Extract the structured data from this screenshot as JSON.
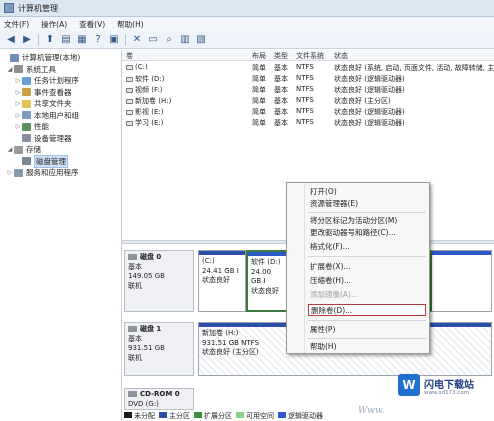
{
  "window": {
    "title": "计算机管理"
  },
  "menu": [
    "文件(F)",
    "操作(A)",
    "查看(V)",
    "帮助(H)"
  ],
  "toolbar": {
    "icons": [
      "back-icon",
      "forward-icon",
      "up-icon",
      "show-tree-icon",
      "properties-icon",
      "help-icon",
      "delete-icon",
      "open-folder-icon",
      "search-icon",
      "export-icon",
      "view-icon"
    ]
  },
  "tree": [
    {
      "label": "计算机管理(本地)",
      "level": 0,
      "expander": ""
    },
    {
      "label": "系统工具",
      "level": 1,
      "expander": "◢"
    },
    {
      "label": "任务计划程序",
      "level": 2,
      "expander": "▷"
    },
    {
      "label": "事件查看器",
      "level": 2,
      "expander": "▷"
    },
    {
      "label": "共享文件夹",
      "level": 2,
      "expander": "▷"
    },
    {
      "label": "本地用户和组",
      "level": 2,
      "expander": "▷"
    },
    {
      "label": "性能",
      "level": 2,
      "expander": "▷"
    },
    {
      "label": "设备管理器",
      "level": 2,
      "expander": ""
    },
    {
      "label": "存储",
      "level": 1,
      "expander": "◢"
    },
    {
      "label": "磁盘管理",
      "level": 2,
      "expander": ""
    },
    {
      "label": "服务和应用程序",
      "level": 1,
      "expander": "▷"
    }
  ],
  "volume_table": {
    "headers": [
      "卷",
      "布局",
      "类型",
      "文件系统",
      "状态"
    ],
    "rows": [
      [
        "(C:)",
        "简单",
        "基本",
        "NTFS",
        "状态良好 (系统, 启动, 页面文件, 活动, 故障转储, 主分区)"
      ],
      [
        "软件 (D:)",
        "简单",
        "基本",
        "NTFS",
        "状态良好 (逻辑驱动器)"
      ],
      [
        "视频 (F:)",
        "简单",
        "基本",
        "NTFS",
        "状态良好 (逻辑驱动器)"
      ],
      [
        "新加卷 (H:)",
        "简单",
        "基本",
        "NTFS",
        "状态良好 (主分区)"
      ],
      [
        "影视 (E:)",
        "简单",
        "基本",
        "NTFS",
        "状态良好 (逻辑驱动器)"
      ],
      [
        "学习 (E:)",
        "简单",
        "基本",
        "NTFS",
        "状态良好 (逻辑驱动器)"
      ]
    ]
  },
  "disks": [
    {
      "name": "磁盘 0",
      "type": "基本",
      "size": "149.05 GB",
      "status": "联机"
    },
    {
      "name": "磁盘 1",
      "type": "基本",
      "size": "931.51 GB",
      "status": "联机"
    },
    {
      "name": "CD-ROM 0",
      "type": "DVD (G:)",
      "size": "",
      "status": ""
    }
  ],
  "disk0_parts": [
    {
      "name": "(C:)",
      "size": "24.41 GB I",
      "status": "状态良好"
    },
    {
      "name": "软件 (D:)",
      "size": "24.00 GB I",
      "status": "状态良好"
    }
  ],
  "disk1_part": {
    "name": "新加卷 (H:)",
    "size": "931.51 GB NTFS",
    "status": "状态良好 (主分区)"
  },
  "legend": [
    "未分配",
    "主分区",
    "扩展分区",
    "可用空间",
    "逻辑驱动器"
  ],
  "legend_colors": [
    "#1a1a1a",
    "#2a4fa8",
    "#3f8f3f",
    "#8bd38b",
    "#2f58c8"
  ],
  "context_menu": {
    "items": [
      "打开(O)",
      "资源管理器(E)",
      "将分区标记为活动分区(M)",
      "更改驱动器号和路径(C)...",
      "格式化(F)...",
      "扩展卷(X)...",
      "压缩卷(H)...",
      "添加镜像(A)...",
      "删除卷(D)...",
      "属性(P)",
      "帮助(H)"
    ]
  },
  "watermark": {
    "logo_char": "W",
    "brand": "闪电下载站",
    "url": "www.sd173.com",
    "www": "Www."
  }
}
